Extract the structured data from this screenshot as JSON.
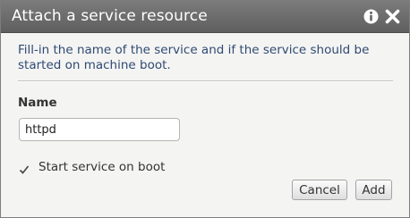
{
  "dialog": {
    "title": "Attach a service resource",
    "description": "Fill-in the name of the service and if the service should be started on machine boot.",
    "name_field": {
      "label": "Name",
      "value": "httpd"
    },
    "start_on_boot": {
      "label": "Start service on boot",
      "checked": true
    },
    "buttons": {
      "cancel": "Cancel",
      "add": "Add"
    },
    "icons": {
      "info": "info-icon",
      "close": "close-icon"
    }
  }
}
